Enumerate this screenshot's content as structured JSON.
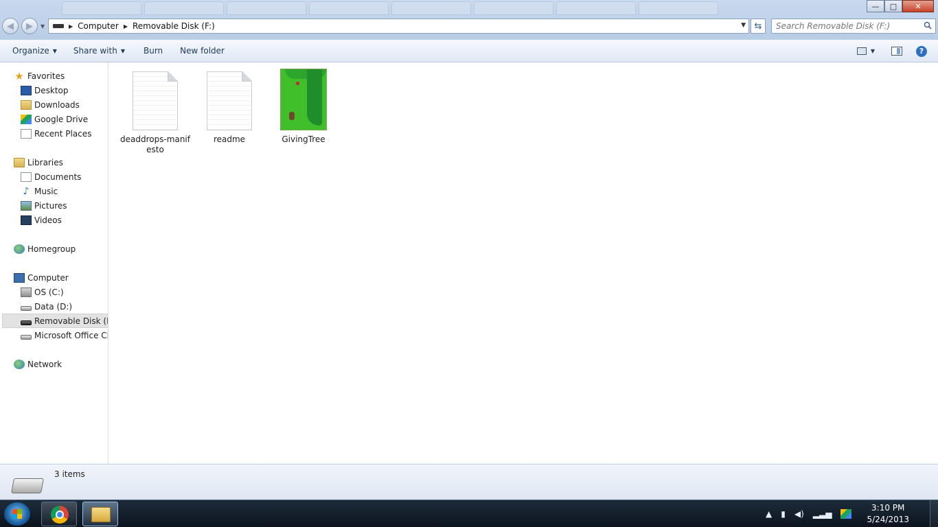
{
  "window": {
    "address": {
      "crumbs": [
        "Computer",
        "Removable Disk (F:)"
      ]
    },
    "search": {
      "placeholder": "Search Removable Disk (F:)"
    },
    "controls": {
      "minimize": "—",
      "maximize": "□",
      "close": "✕"
    }
  },
  "toolbar": {
    "organize": "Organize",
    "share_with": "Share with",
    "burn": "Burn",
    "new_folder": "New folder",
    "help": "?"
  },
  "sidebar": {
    "favorites": {
      "label": "Favorites",
      "items": [
        "Desktop",
        "Downloads",
        "Google Drive",
        "Recent Places"
      ]
    },
    "libraries": {
      "label": "Libraries",
      "items": [
        "Documents",
        "Music",
        "Pictures",
        "Videos"
      ]
    },
    "homegroup": {
      "label": "Homegroup"
    },
    "computer": {
      "label": "Computer",
      "items": [
        "OS (C:)",
        "Data (D:)",
        "Removable Disk (F:)",
        "Microsoft Office Clic"
      ],
      "selected": "Removable Disk (F:)"
    },
    "network": {
      "label": "Network"
    }
  },
  "files": [
    {
      "name": "deaddrops-manifesto",
      "name_display_line1": "deaddrops-manif",
      "name_display_line2": "esto",
      "kind": "text-document"
    },
    {
      "name": "readme",
      "kind": "text-document"
    },
    {
      "name": "GivingTree",
      "kind": "image"
    }
  ],
  "details": {
    "count": "3 items"
  },
  "taskbar": {
    "pinned": [
      "chrome-icon",
      "windows-explorer-icon"
    ],
    "clock": {
      "time": "3:10 PM",
      "date": "5/24/2013"
    }
  }
}
